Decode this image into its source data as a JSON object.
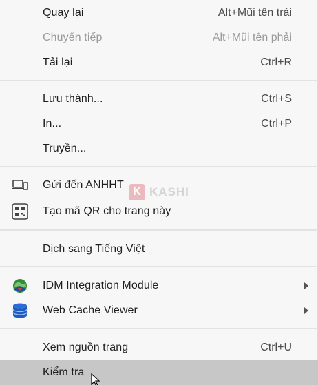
{
  "menu": {
    "groups": [
      {
        "items": [
          {
            "label": "Quay lại",
            "shortcut": "Alt+Mũi tên trái",
            "disabled": false
          },
          {
            "label": "Chuyển tiếp",
            "shortcut": "Alt+Mũi tên phải",
            "disabled": true
          },
          {
            "label": "Tải lại",
            "shortcut": "Ctrl+R",
            "disabled": false
          }
        ]
      },
      {
        "items": [
          {
            "label": "Lưu thành...",
            "shortcut": "Ctrl+S"
          },
          {
            "label": "In...",
            "shortcut": "Ctrl+P"
          },
          {
            "label": "Truyền..."
          }
        ]
      },
      {
        "items": [
          {
            "label": "Gửi đến ANHHT",
            "icon": "laptop-phone-icon"
          },
          {
            "label": "Tạo mã QR cho trang này",
            "icon": "qr-code-icon"
          }
        ]
      },
      {
        "items": [
          {
            "label": "Dịch sang Tiếng Việt"
          }
        ]
      },
      {
        "items": [
          {
            "label": "IDM Integration Module",
            "icon": "idm-globe-icon",
            "submenu": true
          },
          {
            "label": "Web Cache Viewer",
            "icon": "database-icon",
            "submenu": true
          }
        ]
      },
      {
        "items": [
          {
            "label": "Xem nguồn trang",
            "shortcut": "Ctrl+U"
          },
          {
            "label": "Kiểm tra",
            "highlighted": true
          }
        ]
      }
    ]
  },
  "watermark": {
    "badge": "K",
    "text": "KASHI"
  },
  "colors": {
    "background": "#f7f7f7",
    "highlight": "#c7c7c7",
    "separator": "#e3e3e3",
    "disabled_text": "#9a9a9a"
  }
}
